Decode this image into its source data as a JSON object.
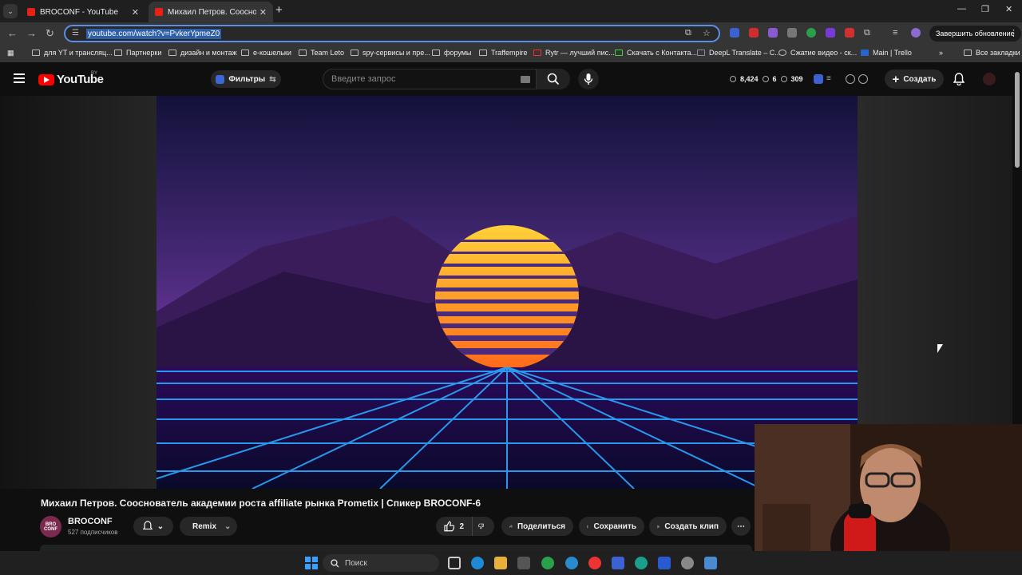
{
  "browser": {
    "tabs": [
      {
        "label": "BROCONF - YouTube",
        "active": false
      },
      {
        "label": "Михаил Петров. Сооснователь академии роста affiliate рынка Prometix",
        "active": true
      }
    ],
    "url": "youtube.com/watch?v=PvkerYpmeZ0",
    "update_label": "Завершить обновление",
    "bookmarks": [
      "для YT и трансляц...",
      "Партнерки",
      "дизайн и монтаж",
      "e-кошельки",
      "Team Leto",
      "spy-сервисы и пре...",
      "форумы",
      "Traffempire",
      "Rytr — лучший пис...",
      "Скачать с Контакта...",
      "DeepL Translate – С...",
      "Сжатие видео - ск...",
      "Main | Trello"
    ],
    "all_bookmarks": "Все закладки"
  },
  "youtube": {
    "logo": "YouTube",
    "country": "BY",
    "filters_label": "Фильтры",
    "search_placeholder": "Введите запрос",
    "stats": {
      "views": "8,424",
      "a": "6",
      "b": "309"
    },
    "create_label": "Создать",
    "video_title": "Михаил Петров. Сооснователь академии роста affiliate рынка Prometix | Спикер BROCONF-6",
    "channel": {
      "name": "BROCONF",
      "avatar_text": "BRO CONF",
      "subscribers": "527 подписчиков"
    },
    "remix_label": "Remix",
    "like_count": "2",
    "share_label": "Поделиться",
    "save_label": "Сохранить",
    "clip_label": "Создать клип"
  },
  "taskbar": {
    "search_placeholder": "Поиск"
  }
}
